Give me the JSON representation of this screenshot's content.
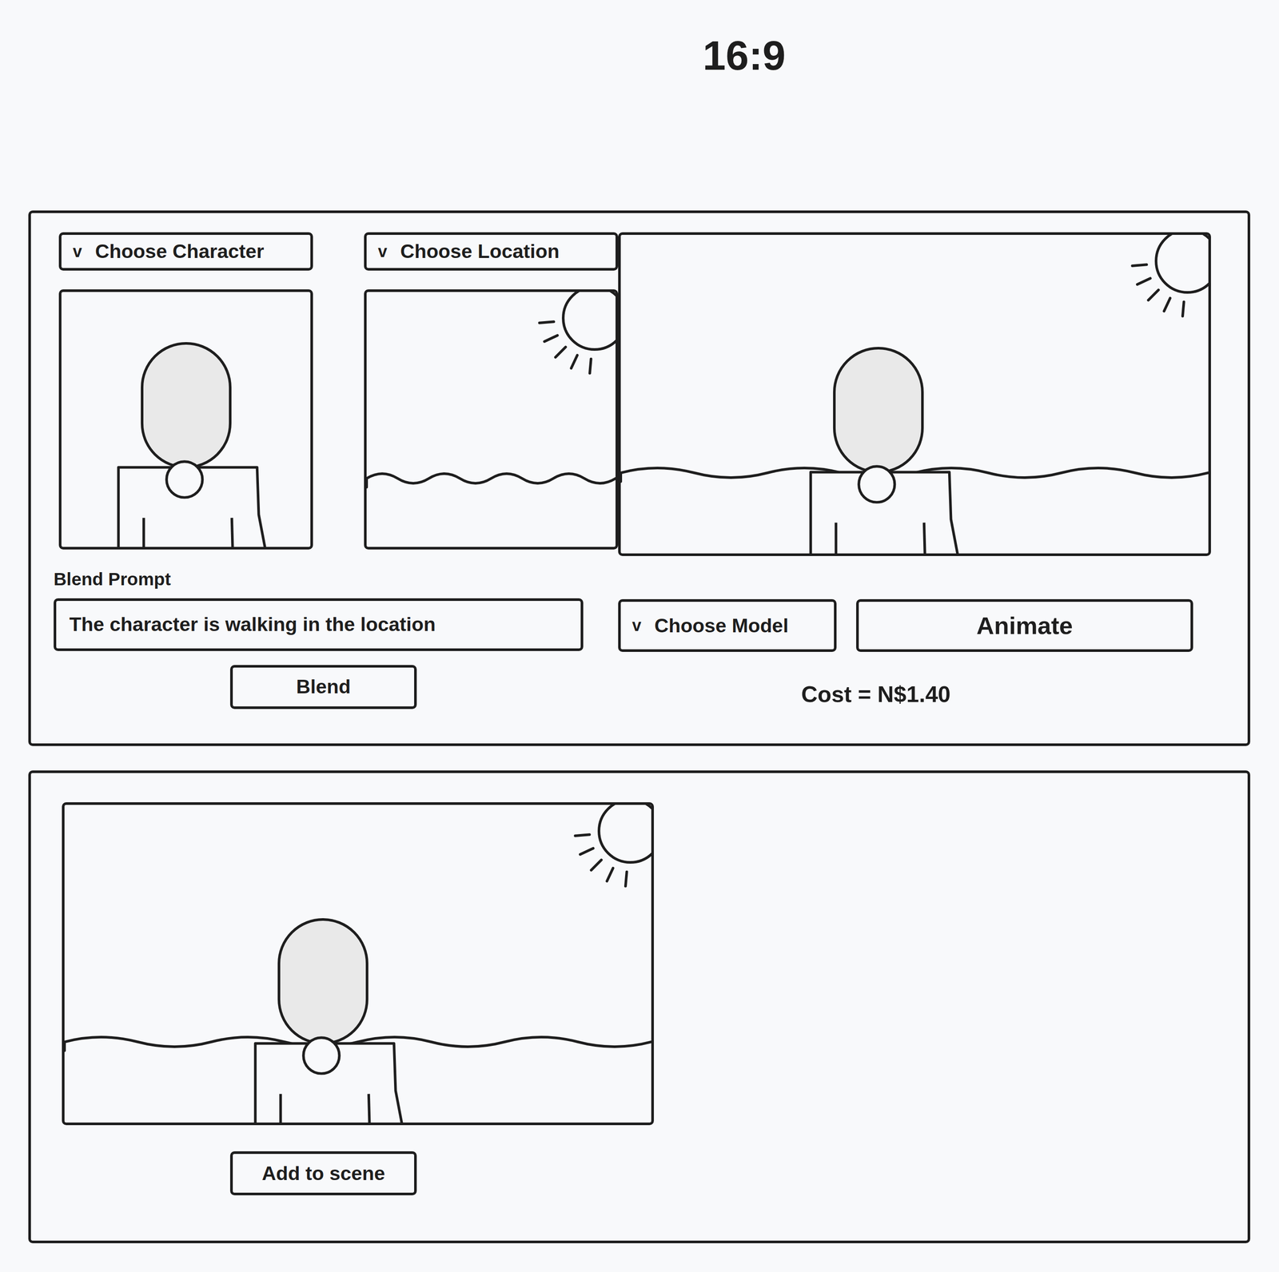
{
  "title": "16:9",
  "character_select": {
    "chevron": "v",
    "label": "Choose Character"
  },
  "location_select": {
    "chevron": "v",
    "label": "Choose Location"
  },
  "blend_prompt": {
    "label": "Blend Prompt",
    "value": "The character is walking in the location"
  },
  "blend_button": "Blend",
  "model_select": {
    "chevron": "v",
    "label": "Choose Model"
  },
  "animate_button": "Animate",
  "cost": "Cost = N$1.40",
  "add_button": "Add to scene"
}
